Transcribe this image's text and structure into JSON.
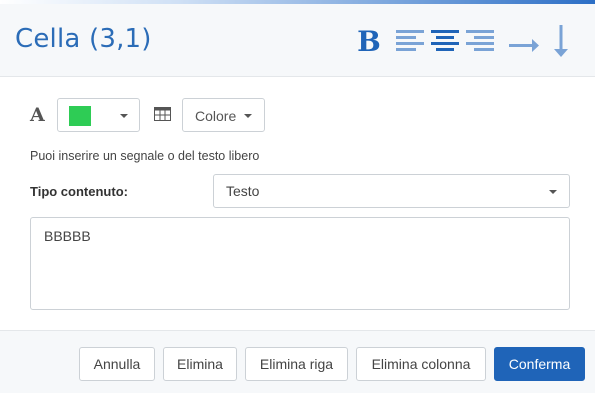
{
  "dialog": {
    "title": "Cella (3,1)"
  },
  "toolbar": {
    "bold_label": "B",
    "align_icons": [
      "align-left-icon",
      "align-center-icon",
      "align-right-icon"
    ],
    "direction_icons": [
      "arrow-right-icon",
      "arrow-down-icon"
    ],
    "accent_color": "#1f64b8",
    "icon_color": "#7aa3d6"
  },
  "format": {
    "font_icon_label": "A",
    "text_color": "#2ecc55",
    "background_label": "Colore"
  },
  "hint": "Puoi inserire un segnale o del testo libero",
  "content_type": {
    "label": "Tipo contenuto:",
    "value": "Testo"
  },
  "content": {
    "value": "BBBBB"
  },
  "buttons": {
    "cancel": "Annulla",
    "delete": "Elimina",
    "delete_row": "Elimina riga",
    "delete_column": "Elimina colonna",
    "confirm": "Conferma"
  }
}
